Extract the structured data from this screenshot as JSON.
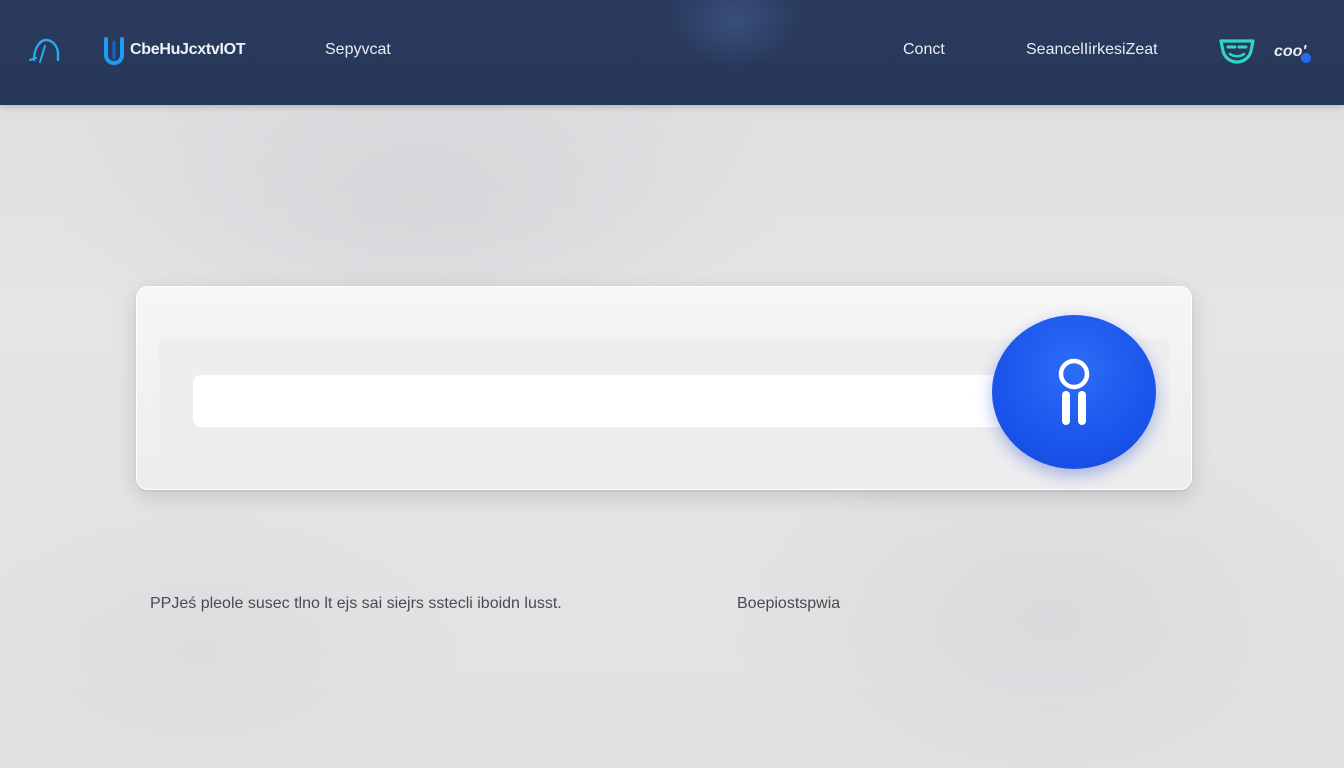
{
  "header": {
    "brand_name": "CbeHuJcxtvIOT",
    "nav_link": "Sepyvcat",
    "contact_link": "Conct",
    "search_link": "SeancelIirkesiZeat",
    "user_label": "coo'",
    "icons": {
      "left": "hook-icon",
      "brand": "brand-logo-icon",
      "right": "mask-icon",
      "notification": "notification-dot-icon"
    }
  },
  "search": {
    "placeholder": "",
    "value": "",
    "button_icon": "person-icon"
  },
  "info": {
    "left_text": "PPJeś pleole susec tlno lt ejs sai siejrs sstecli iboidn lusst.",
    "right_text": "Boepiostspwia"
  },
  "colors": {
    "header_bg": "#28395a",
    "accent_blue": "#1a55ec",
    "teal_icon": "#2fd6c8",
    "brand_logo_blue": "#1e9bf0",
    "page_bg": "#e4e4e6"
  }
}
